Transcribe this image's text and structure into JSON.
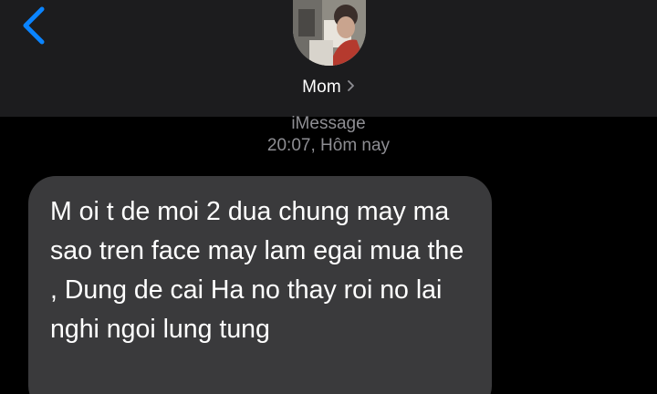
{
  "header": {
    "back_icon": "chevron-left-icon",
    "accent_color": "#0a84ff",
    "contact_name": "Mom",
    "contact_chevron_icon": "chevron-right-icon"
  },
  "meta": {
    "service": "iMessage",
    "timestamp": "20:07, Hôm nay"
  },
  "messages": [
    {
      "direction": "incoming",
      "text": "M oi t de moi 2 dua chung may ma sao tren face may lam egai mua the , Dung de cai Ha no thay roi no lai nghi ngoi lung tung"
    }
  ]
}
